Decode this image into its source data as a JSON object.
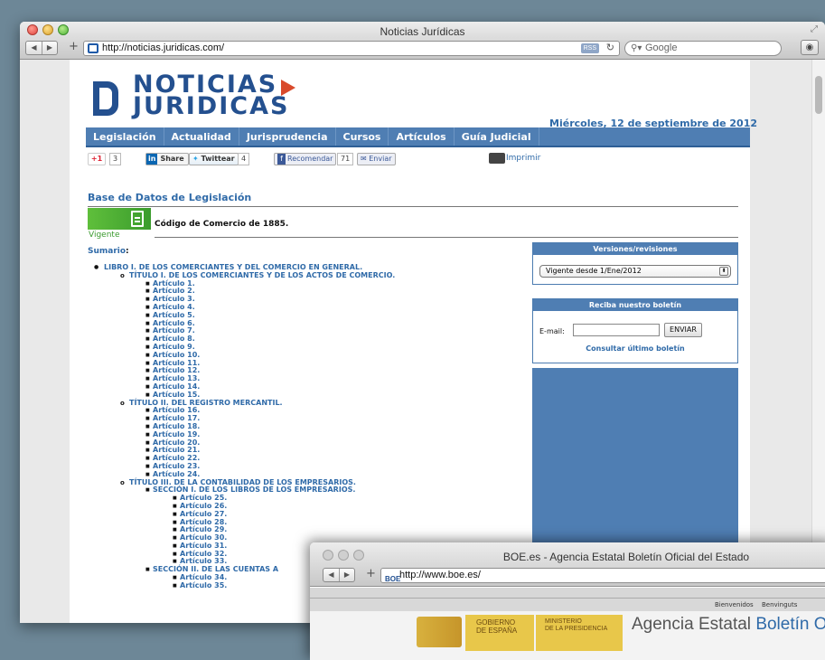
{
  "window1": {
    "title": "Noticias Jurídicas",
    "url": "http://noticias.juridicas.com/",
    "rss": "RSS",
    "search_placeholder": "Google"
  },
  "site": {
    "logo_line1": "NOTICIAS",
    "logo_line2": "JURIDICAS",
    "date": "Miércoles, 12 de septiembre de 2012",
    "nav": [
      "Legislación",
      "Actualidad",
      "Jurisprudencia",
      "Cursos",
      "Artículos",
      "Guía Judicial"
    ],
    "social": {
      "gplus": "+1",
      "gplus_count": "3",
      "linkedin": "Share",
      "twitter": "Twittear",
      "twitter_count": "4",
      "facebook": "Recomendar",
      "facebook_count": "71",
      "send": "Enviar",
      "print": "Imprimir"
    },
    "db_title": "Base de Datos de Legislación",
    "code_title": "Código de Comercio de 1885.",
    "status": "Vigente",
    "summary_label": "Sumario"
  },
  "toc": [
    {
      "level": 1,
      "text": "LIBRO I. DE LOS COMERCIANTES Y DEL COMERCIO EN GENERAL."
    },
    {
      "level": 2,
      "text": "TÍTULO I. DE LOS COMERCIANTES Y DE LOS ACTOS DE COMERCIO."
    },
    {
      "level": 3,
      "text": "Artículo 1."
    },
    {
      "level": 3,
      "text": "Artículo 2."
    },
    {
      "level": 3,
      "text": "Artículo 3."
    },
    {
      "level": 3,
      "text": "Artículo 4."
    },
    {
      "level": 3,
      "text": "Artículo 5."
    },
    {
      "level": 3,
      "text": "Artículo 6."
    },
    {
      "level": 3,
      "text": "Artículo 7."
    },
    {
      "level": 3,
      "text": "Artículo 8."
    },
    {
      "level": 3,
      "text": "Artículo 9."
    },
    {
      "level": 3,
      "text": "Artículo 10."
    },
    {
      "level": 3,
      "text": "Artículo 11."
    },
    {
      "level": 3,
      "text": "Artículo 12."
    },
    {
      "level": 3,
      "text": "Artículo 13."
    },
    {
      "level": 3,
      "text": "Artículo 14."
    },
    {
      "level": 3,
      "text": "Artículo 15."
    },
    {
      "level": 2,
      "text": "TÍTULO II. DEL REGISTRO MERCANTIL."
    },
    {
      "level": 3,
      "text": "Artículo 16."
    },
    {
      "level": 3,
      "text": "Artículo 17."
    },
    {
      "level": 3,
      "text": "Artículo 18."
    },
    {
      "level": 3,
      "text": "Artículo 19."
    },
    {
      "level": 3,
      "text": "Artículo 20."
    },
    {
      "level": 3,
      "text": "Artículo 21."
    },
    {
      "level": 3,
      "text": "Artículo 22."
    },
    {
      "level": 3,
      "text": "Artículo 23."
    },
    {
      "level": 3,
      "text": "Artículo 24."
    },
    {
      "level": 2,
      "text": "TÍTULO III. DE LA CONTABILIDAD DE LOS EMPRESARIOS."
    },
    {
      "level": 3,
      "text": "SECCIÓN I. DE LOS LIBROS DE LOS EMPRESARIOS."
    },
    {
      "level": 4,
      "text": "Artículo 25."
    },
    {
      "level": 4,
      "text": "Artículo 26."
    },
    {
      "level": 4,
      "text": "Artículo 27."
    },
    {
      "level": 4,
      "text": "Artículo 28."
    },
    {
      "level": 4,
      "text": "Artículo 29."
    },
    {
      "level": 4,
      "text": "Artículo 30."
    },
    {
      "level": 4,
      "text": "Artículo 31."
    },
    {
      "level": 4,
      "text": "Artículo 32."
    },
    {
      "level": 4,
      "text": "Artículo 33."
    },
    {
      "level": 3,
      "text": "SECCIÓN II. DE LAS CUENTAS A"
    },
    {
      "level": 4,
      "text": "Artículo 34."
    },
    {
      "level": 4,
      "text": "Artículo 35."
    }
  ],
  "sidebar": {
    "versions_title": "Versiones/revisiones",
    "versions_selected": "Vigente desde 1/Ene/2012",
    "newsletter_title": "Reciba nuestro boletín",
    "email_label": "E-mail:",
    "send_button": "ENVIAR",
    "latest_link": "Consultar último boletín"
  },
  "window2": {
    "title": "BOE.es - Agencia Estatal Boletín Oficial del Estado",
    "url": "http://www.boe.es/",
    "fav_text": "BOE",
    "top_links": [
      "Bienvenidos",
      "Benvinguts"
    ],
    "gob_line1": "GOBIERNO",
    "gob_line2": "DE ESPAÑA",
    "ministry_line1": "MINISTERIO",
    "ministry_line2": "DE LA PRESIDENCIA",
    "agency_prefix": "Agencia Estatal ",
    "agency_blue": "Boletín O"
  }
}
